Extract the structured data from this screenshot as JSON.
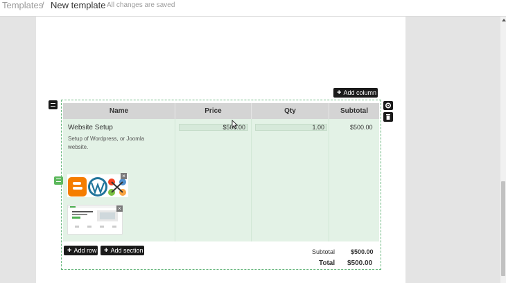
{
  "header": {
    "breadcrumb_root": "Templates",
    "breadcrumb_sep": "/",
    "breadcrumb_current": "New template",
    "save_status": "All changes are saved"
  },
  "toolbar": {
    "add_column": "Add column",
    "add_row": "Add row",
    "add_section": "Add section"
  },
  "table": {
    "columns": [
      "Name",
      "Price",
      "Qty",
      "Subtotal"
    ],
    "rows": [
      {
        "name": "Website Setup",
        "description": "Setup of Wordpress, or Joomla website.",
        "price": "$500.00",
        "qty": "1.00",
        "subtotal": "$500.00"
      }
    ]
  },
  "totals": {
    "subtotal_label": "Subtotal",
    "subtotal_value": "$500.00",
    "total_label": "Total",
    "total_value": "$500.00"
  },
  "images": {
    "logos": [
      "blogger-logo",
      "wordpress-logo",
      "joomla-logo"
    ],
    "thumbnail": "website-thumbnail"
  },
  "colors": {
    "accent_dark": "#1a1a1a",
    "block_border": "#67b77d",
    "row_fill": "#e3f2e6",
    "header_fill": "#d4d4d4"
  }
}
